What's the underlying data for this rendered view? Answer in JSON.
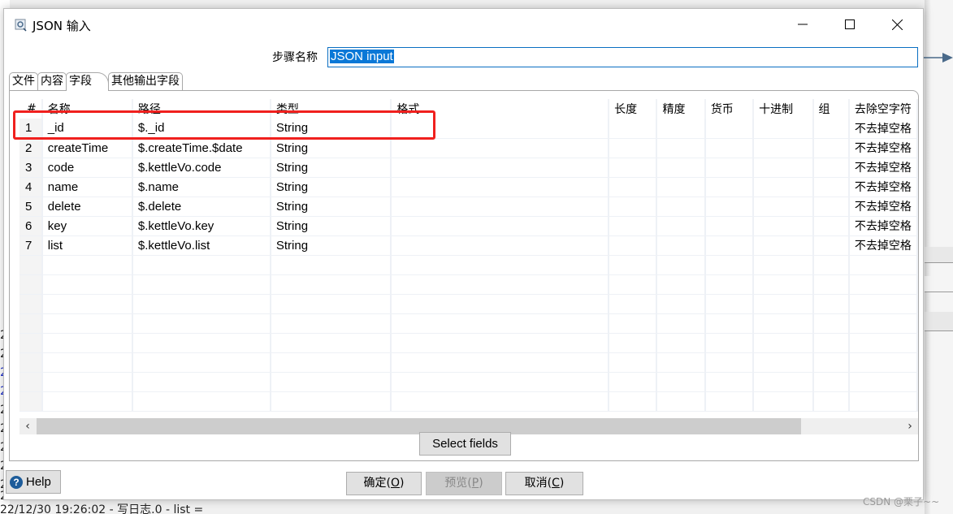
{
  "window": {
    "title": "JSON 输入",
    "minimize_label": "minimize",
    "maximize_label": "maximize",
    "close_label": "close"
  },
  "step": {
    "label": "步骤名称",
    "value": "JSON input"
  },
  "tabs": [
    {
      "label": "文件",
      "active": false
    },
    {
      "label": "内容",
      "active": false
    },
    {
      "label": "字段",
      "active": true
    },
    {
      "label": "其他输出字段",
      "active": false
    }
  ],
  "table": {
    "columns": [
      "#",
      "名称",
      "路径",
      "类型",
      "格式",
      "长度",
      "精度",
      "货币",
      "十进制",
      "组",
      "去除空字符"
    ],
    "rows": [
      {
        "num": "1",
        "name": "_id",
        "path": "$._id",
        "type": "String",
        "format": "",
        "length": "",
        "precision": "",
        "currency": "",
        "decimal": "",
        "group": "",
        "trim": "不去掉空格"
      },
      {
        "num": "2",
        "name": "createTime",
        "path": "$.createTime.$date",
        "type": "String",
        "format": "",
        "length": "",
        "precision": "",
        "currency": "",
        "decimal": "",
        "group": "",
        "trim": "不去掉空格"
      },
      {
        "num": "3",
        "name": "code",
        "path": "$.kettleVo.code",
        "type": "String",
        "format": "",
        "length": "",
        "precision": "",
        "currency": "",
        "decimal": "",
        "group": "",
        "trim": "不去掉空格"
      },
      {
        "num": "4",
        "name": "name",
        "path": "$.name",
        "type": "String",
        "format": "",
        "length": "",
        "precision": "",
        "currency": "",
        "decimal": "",
        "group": "",
        "trim": "不去掉空格"
      },
      {
        "num": "5",
        "name": "delete",
        "path": "$.delete",
        "type": "String",
        "format": "",
        "length": "",
        "precision": "",
        "currency": "",
        "decimal": "",
        "group": "",
        "trim": "不去掉空格"
      },
      {
        "num": "6",
        "name": "key",
        "path": "$.kettleVo.key",
        "type": "String",
        "format": "",
        "length": "",
        "precision": "",
        "currency": "",
        "decimal": "",
        "group": "",
        "trim": "不去掉空格"
      },
      {
        "num": "7",
        "name": "list",
        "path": "$.kettleVo.list",
        "type": "String",
        "format": "",
        "length": "",
        "precision": "",
        "currency": "",
        "decimal": "",
        "group": "",
        "trim": "不去掉空格"
      }
    ],
    "empty_rows": 8,
    "highlighted_row": 1
  },
  "scrollbar": {
    "left_arrow": "‹",
    "right_arrow": "›"
  },
  "buttons": {
    "select_fields": "Select fields",
    "ok": "确定(",
    "ok_key": "O",
    "preview": "预览(",
    "preview_key": "P",
    "cancel": "取消(",
    "cancel_key": "C",
    "close_paren": ")",
    "help": "Help"
  },
  "background": {
    "log_prefix": "2",
    "bottom_log": "22/12/30 19:26:02 - 写日志.0 - list ="
  },
  "watermark": "CSDN @栗子~~",
  "colors": {
    "accent": "#0a78d7",
    "highlight_box": "#f0201e",
    "help_icon": "#1d5c9a"
  }
}
